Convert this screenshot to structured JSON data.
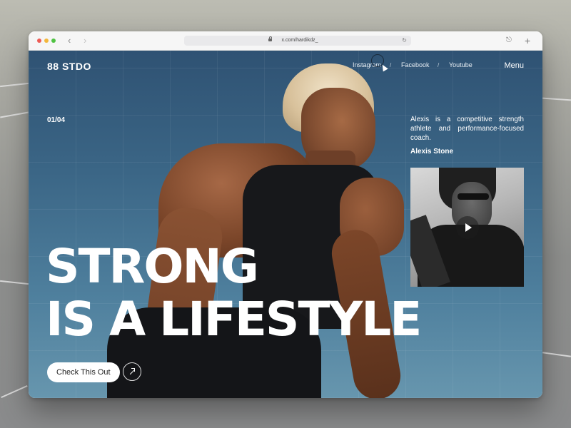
{
  "browser": {
    "url": "x.com/hardikdz_"
  },
  "site": {
    "logo": "88 STDO",
    "nav": [
      "Instagram",
      "Facebook",
      "Youtube"
    ],
    "nav_separator": "/",
    "menu_label": "Menu"
  },
  "hero": {
    "counter": "01/04",
    "description": "Alexis is a competitive strength athlete and performance-focused coach.",
    "author": "Alexis Stone",
    "headline_line1": "STRONG",
    "headline_line2": "IS A LIFESTYLE",
    "cta_label": "Check This Out"
  },
  "colors": {
    "hero_background": "#3b6686",
    "text": "#ffffff",
    "cta_background": "#ffffff"
  }
}
